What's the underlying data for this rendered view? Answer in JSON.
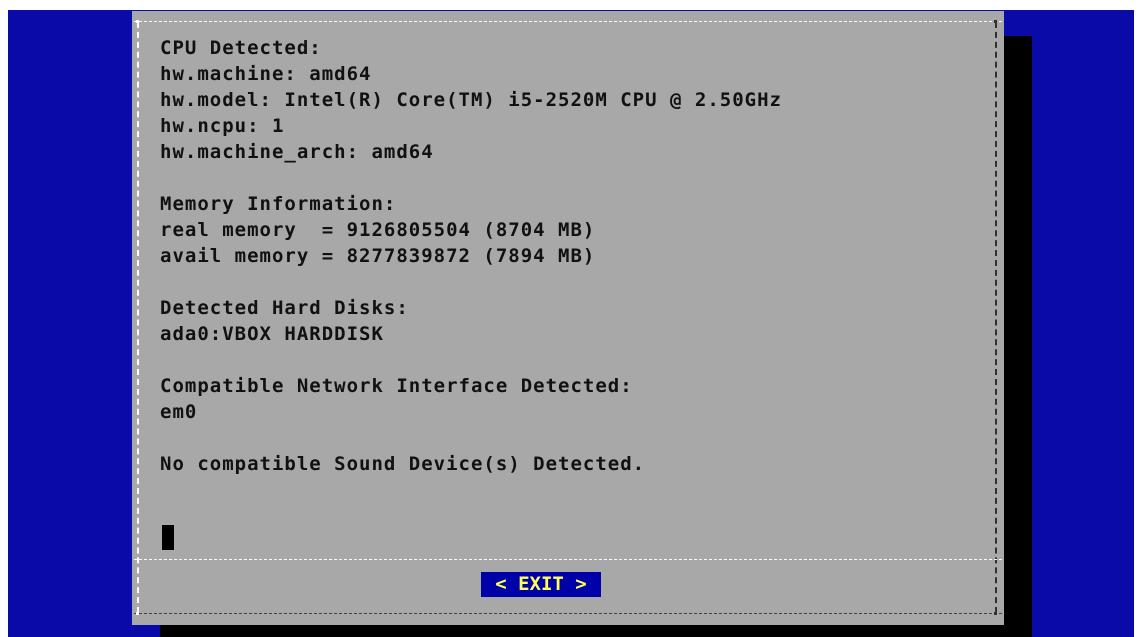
{
  "dialog": {
    "lines": [
      "CPU Detected:",
      "hw.machine: amd64",
      "hw.model: Intel(R) Core(TM) i5-2520M CPU @ 2.50GHz",
      "hw.ncpu: 1",
      "hw.machine_arch: amd64",
      "",
      "Memory Information:",
      "real memory  = 9126805504 (8704 MB)",
      "avail memory = 8277839872 (7894 MB)",
      "",
      "Detected Hard Disks:",
      "ada0:VBOX HARDDISK",
      "",
      "Compatible Network Interface Detected:",
      "em0",
      "",
      "No compatible Sound Device(s) Detected."
    ],
    "exit_label": "< EXIT >"
  },
  "colors": {
    "screen_bg": "#0a0aa8",
    "dialog_bg": "#a8a8a8",
    "button_bg": "#0000a8",
    "button_text": "#ffff55"
  }
}
